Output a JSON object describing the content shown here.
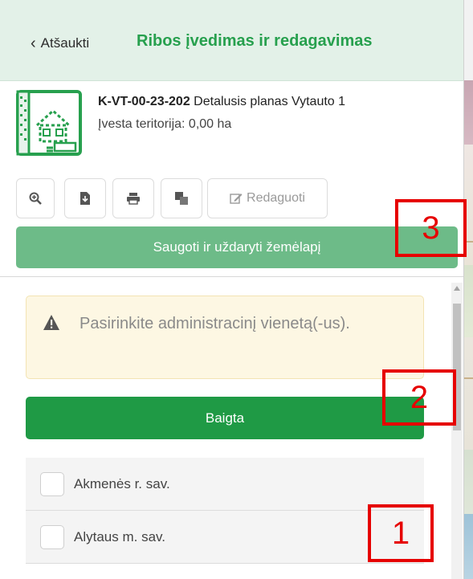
{
  "header": {
    "cancel_label": "Atšaukti",
    "title": "Ribos įvedimas ir redagavimas",
    "accent_color": "#27a04e"
  },
  "info": {
    "icon": "map-plan-icon",
    "code": "K-VT-00-23-202",
    "name": "Detalusis planas Vytauto 1",
    "area": "Įvesta teritorija: 0,00 ha"
  },
  "toolbar": {
    "zoom_icon": "zoom-in-icon",
    "download_icon": "download-file-icon",
    "print_icon": "print-icon",
    "layers_icon": "layers-icon",
    "edit_label": "Redaguoti",
    "edit_icon": "edit-icon"
  },
  "save_button": {
    "label": "Saugoti ir uždaryti žemėlapį",
    "color": "#6dbb88"
  },
  "alert": {
    "icon": "warning-icon",
    "text": "Pasirinkite administracinį vienetą(-us)."
  },
  "done_button": {
    "label": "Baigta",
    "color": "#1f9a45"
  },
  "list": {
    "items": [
      {
        "label": "Akmenės r. sav."
      },
      {
        "label": "Alytaus m. sav."
      }
    ]
  },
  "annotations": [
    {
      "label": "1"
    },
    {
      "label": "2"
    },
    {
      "label": "3"
    }
  ]
}
